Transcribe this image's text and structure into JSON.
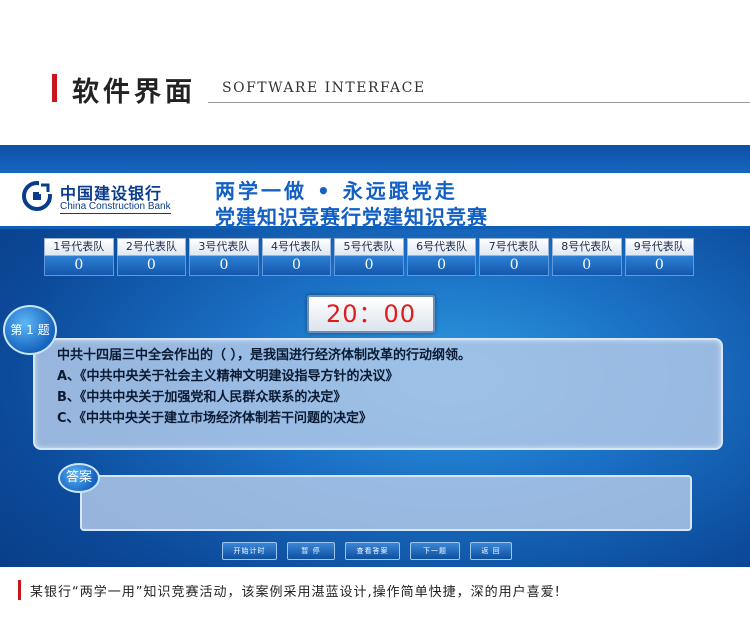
{
  "header": {
    "title": "软件界面",
    "subtitle": "SOFTWARE INTERFACE",
    "accent_color": "#c8161d"
  },
  "app": {
    "bank": {
      "name_cn": "中国建设银行",
      "name_en": "China Construction Bank",
      "logo_icon": "ccb-logo-icon"
    },
    "banner": {
      "line1": "两学一做 • 永远跟党走",
      "line2": "党建知识竞赛行党建知识竞赛",
      "color": "#1260c4"
    },
    "teams": [
      {
        "name": "1号代表队",
        "score": "0"
      },
      {
        "name": "2号代表队",
        "score": "0"
      },
      {
        "name": "3号代表队",
        "score": "0"
      },
      {
        "name": "4号代表队",
        "score": "0"
      },
      {
        "name": "5号代表队",
        "score": "0"
      },
      {
        "name": "6号代表队",
        "score": "0"
      },
      {
        "name": "7号代表队",
        "score": "0"
      },
      {
        "name": "8号代表队",
        "score": "0"
      },
      {
        "name": "9号代表队",
        "score": "0"
      }
    ],
    "timer": "20：00",
    "question": {
      "badge": "第 1 题",
      "text": "中共十四届三中全会作出的（ ），是我国进行经济体制改革的行动纲领。",
      "options": [
        "A、《中共中央关于社会主义精神文明建设指导方针的决议》",
        "B、《中共中央关于加强党和人民群众联系的决定》",
        "C、《中共中央关于建立市场经济体制若干问题的决定》"
      ]
    },
    "answer": {
      "badge": "答案",
      "value": ""
    },
    "controls": {
      "start": "开始计时",
      "pause": "暂 停",
      "view_answer": "查看答案",
      "next": "下一题",
      "back": "返 回"
    }
  },
  "footer": {
    "caption": "某银行“两学一用”知识竞赛活动，该案例采用湛蓝设计,操作简单快捷，深的用户喜爱!"
  }
}
